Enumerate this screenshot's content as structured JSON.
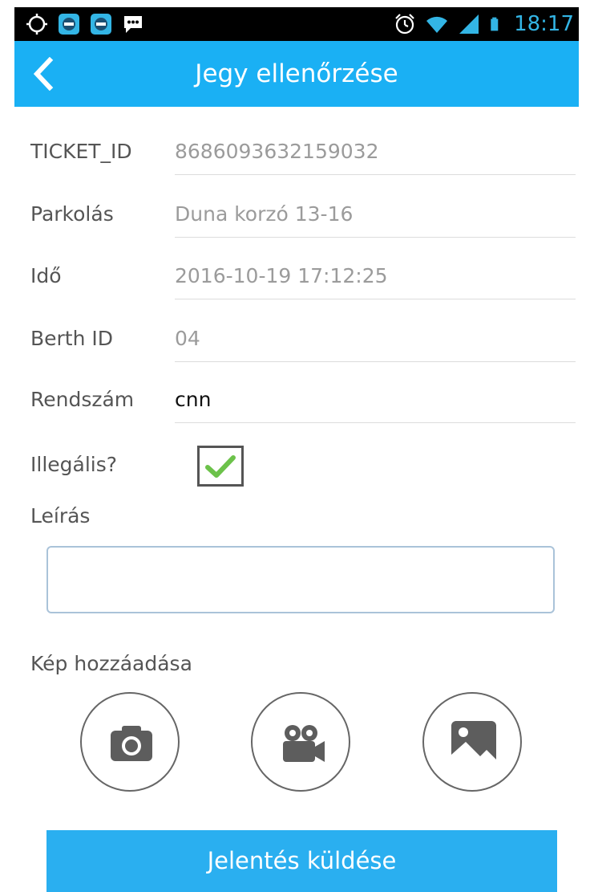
{
  "status_bar": {
    "time": "18:17",
    "icons_left": [
      "gps-icon",
      "app-icon",
      "app-icon",
      "message-icon"
    ],
    "icons_right": [
      "alarm-icon",
      "wifi-icon",
      "signal-icon",
      "battery-icon"
    ]
  },
  "header": {
    "title": "Jegy ellenőrzése",
    "color": "#1ab0f4"
  },
  "form": {
    "fields": [
      {
        "label": "TICKET_ID",
        "value": "8686093632159032"
      },
      {
        "label": "Parkolás",
        "value": "Duna korzó 13-16"
      },
      {
        "label": "Idő",
        "value": "2016-10-19 17:12:25"
      },
      {
        "label": "Berth ID",
        "value": "04"
      },
      {
        "label": "Rendszám",
        "value": "cnn"
      }
    ],
    "illegal_label": "Illegális?",
    "illegal_checked": true,
    "description_label": "Leírás",
    "description_value": "",
    "add_image_label": "Kép hozzáadása",
    "media_buttons": [
      "camera-icon",
      "video-camera-icon",
      "image-gallery-icon"
    ]
  },
  "submit": {
    "label": "Jelentés küldése",
    "color": "#2aaff0"
  }
}
